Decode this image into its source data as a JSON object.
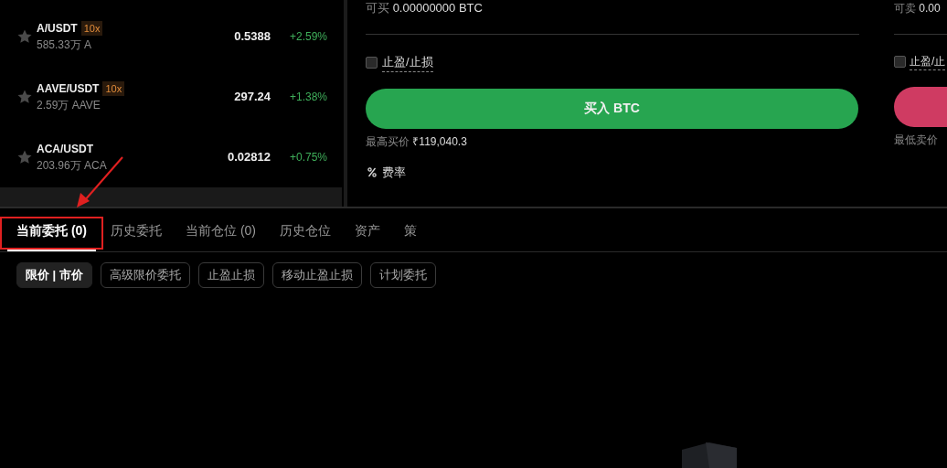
{
  "markets": [
    {
      "pair": "A/USDT",
      "leverage": "10x",
      "volume": "585.33万 A",
      "price": "0.5388",
      "change": "+2.59%"
    },
    {
      "pair": "AAVE/USDT",
      "leverage": "10x",
      "volume": "2.59万 AAVE",
      "price": "297.24",
      "change": "+1.38%"
    },
    {
      "pair": "ACA/USDT",
      "volume": "203.96万 ACA",
      "price": "0.02812",
      "change": "+0.75%"
    }
  ],
  "buy_panel": {
    "available_label": "可买",
    "available": "0.00000000 BTC",
    "tpsl": {
      "label": "止盈/止损",
      "checked": false
    },
    "button": "买入 BTC",
    "best_price_label": "最高买价",
    "best_price": "₹119,040.3",
    "fee_label": "费率"
  },
  "sell_panel": {
    "available_label": "可卖",
    "available": "0.00",
    "tpsl": {
      "label": "止盈/止",
      "checked": false
    },
    "best_price_label": "最低卖价"
  },
  "order_tabs": [
    {
      "label": "当前委托 (0)",
      "selected": true
    },
    {
      "label": "历史委托",
      "selected": false
    },
    {
      "label": "当前仓位 (0)",
      "selected": false
    },
    {
      "label": "历史仓位",
      "selected": false
    },
    {
      "label": "资产",
      "selected": false
    },
    {
      "label": "策",
      "selected": false
    }
  ],
  "order_filters": [
    {
      "label": "限价 | 市价",
      "selected": true
    },
    {
      "label": "高级限价委托",
      "selected": false
    },
    {
      "label": "止盈止损",
      "selected": false
    },
    {
      "label": "移动止盈止损",
      "selected": false
    },
    {
      "label": "计划委托",
      "selected": false
    }
  ]
}
